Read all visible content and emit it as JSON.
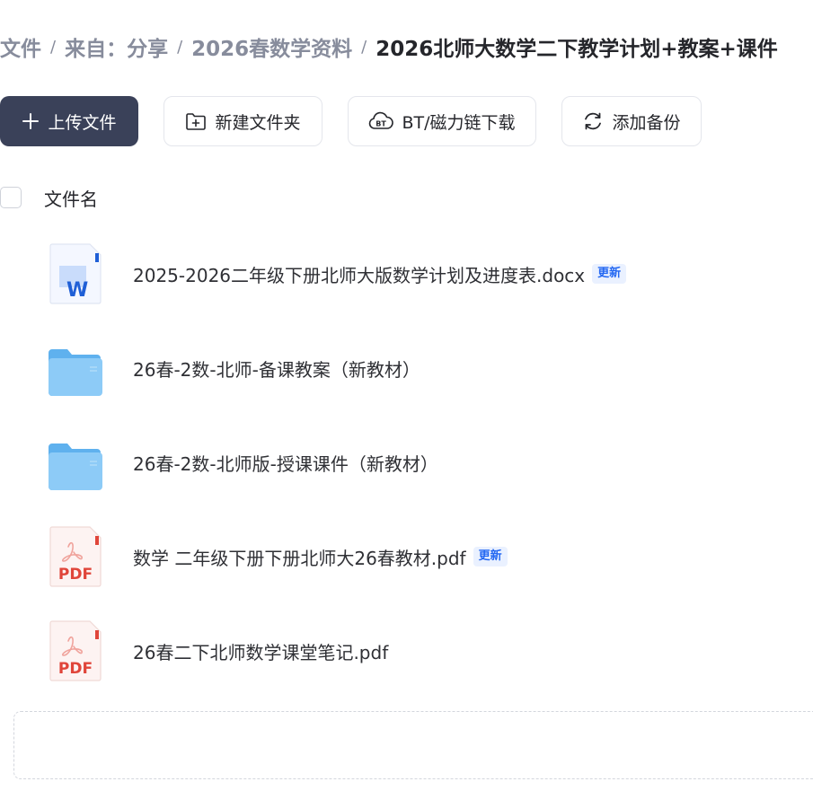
{
  "breadcrumb": {
    "items": [
      "文件",
      "来自：分享",
      "2026春数学资料"
    ],
    "current": "2026北师大数学二下教学计划+教案+课件",
    "separator": "/"
  },
  "toolbar": {
    "upload_label": "上传文件",
    "new_folder_label": "新建文件夹",
    "bt_label": "BT/磁力链下载",
    "backup_label": "添加备份"
  },
  "list": {
    "column_name": "文件名",
    "files": [
      {
        "name": "2025-2026二年级下册北师大版数学计划及进度表.docx",
        "type": "word",
        "badge": "更新"
      },
      {
        "name": "26春-2数-北师-备课教案（新教材）",
        "type": "folder",
        "badge": ""
      },
      {
        "name": "26春-2数-北师版-授课课件（新教材）",
        "type": "folder",
        "badge": ""
      },
      {
        "name": "数学 二年级下册下册北师大26春教材.pdf",
        "type": "pdf",
        "badge": "更新"
      },
      {
        "name": "26春二下北师数学课堂笔记.pdf",
        "type": "pdf",
        "badge": ""
      }
    ]
  },
  "icons": {
    "word_letter": "W",
    "pdf_label": "PDF",
    "bt_glyph": "BT"
  },
  "colors": {
    "primary_button": "#3a4159",
    "badge_text": "#2468f2",
    "folder": "#7cc3f5",
    "pdf_red": "#e0453a",
    "word_blue": "#1f5fd6"
  }
}
